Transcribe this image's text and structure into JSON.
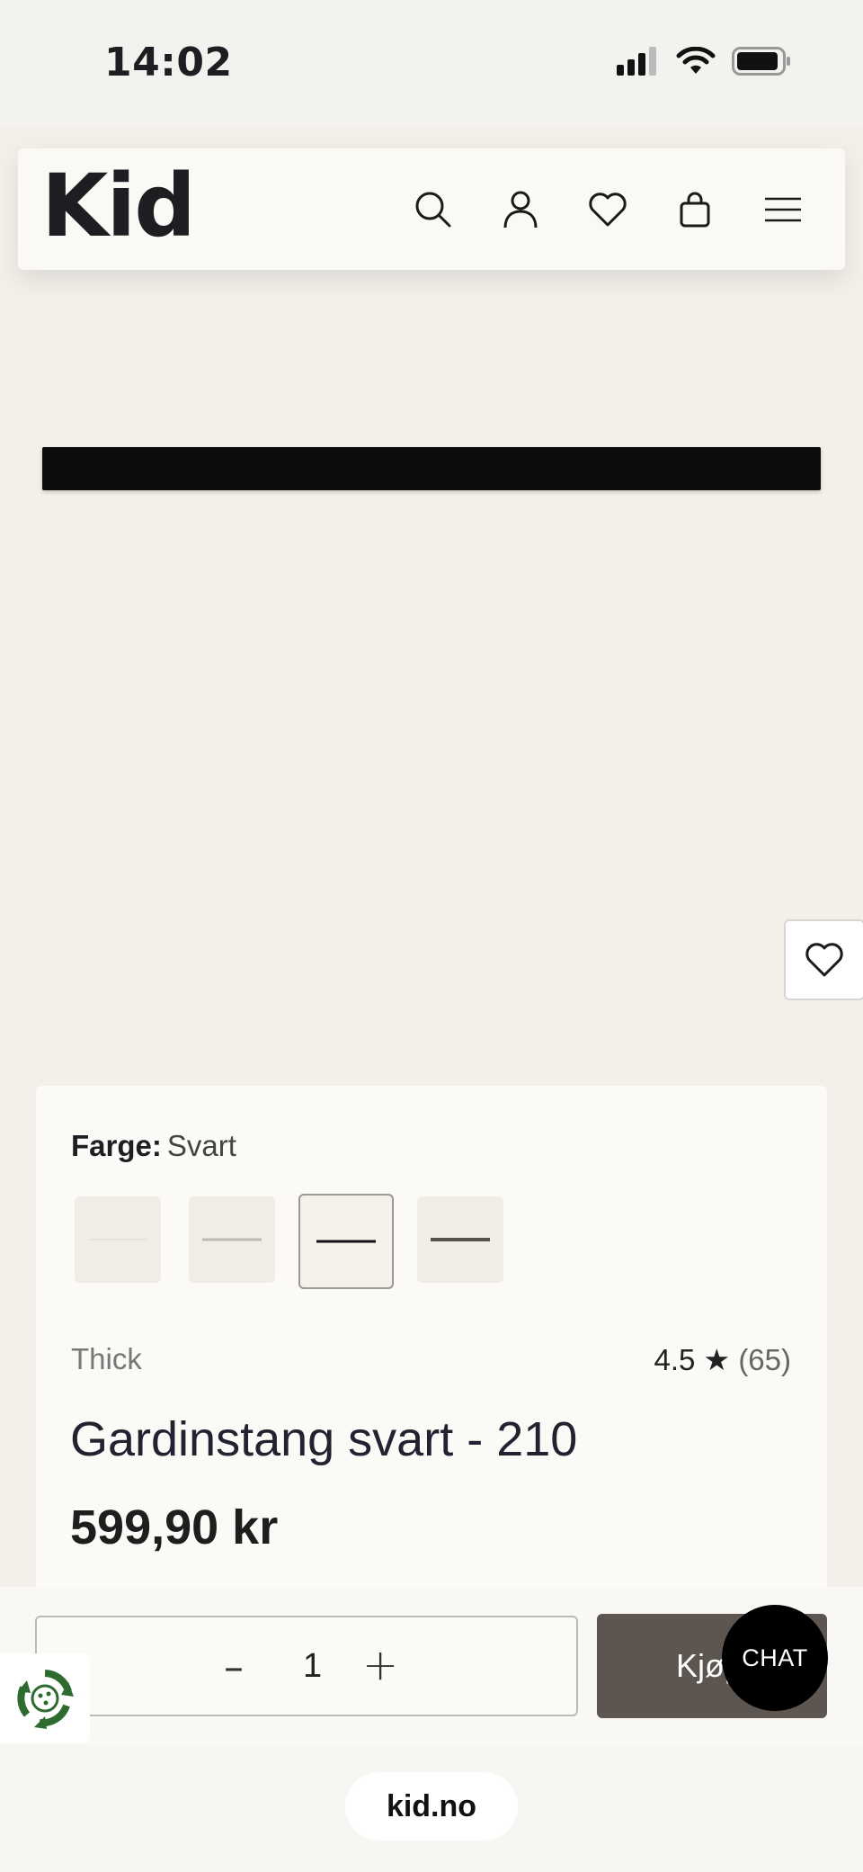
{
  "status_bar": {
    "time": "14:02"
  },
  "header": {
    "logo": "Kid",
    "icons": [
      "search-icon",
      "account-icon",
      "heart-icon",
      "bag-icon",
      "menu-icon"
    ]
  },
  "product": {
    "color_label": "Farge:",
    "color_value": "Svart",
    "swatches": [
      "Hvit",
      "Sølv",
      "Svart",
      "Antikk"
    ],
    "selected_swatch_index": 2,
    "subtitle": "Thick",
    "rating_value": "4.5",
    "rating_star": "★",
    "rating_count": "(65)",
    "title": "Gardinstang svart - 210",
    "price": "599,90 kr"
  },
  "purchase": {
    "minus": "–",
    "quantity": "1",
    "plus": "+",
    "buy_label": "Kjøp"
  },
  "chat": {
    "label": "CHAT"
  },
  "browser": {
    "url": "kid.no"
  },
  "colors": {
    "buy_button": "#5d5650",
    "background": "#f3f0ea"
  }
}
